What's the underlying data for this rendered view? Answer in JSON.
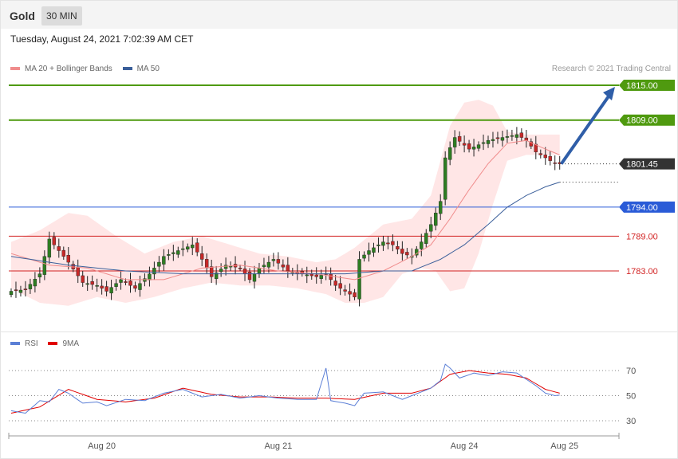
{
  "header": {
    "symbol": "Gold",
    "interval": "30 MIN"
  },
  "timestamp": "Tuesday, August 24, 2021 7:02:39 AM CET",
  "legend": {
    "main": [
      {
        "label": "MA 20 + Bollinger Bands",
        "color": "#f08c8c"
      },
      {
        "label": "MA 50",
        "color": "#3b5f9a"
      }
    ],
    "rsi": [
      {
        "label": "RSI",
        "color": "#5b7fd6"
      },
      {
        "label": "9MA",
        "color": "#e00000"
      }
    ]
  },
  "credit": "Research © 2021 Trading Central",
  "chart_data": [
    {
      "type": "candlestick",
      "ylim": [
        1776,
        1818
      ],
      "levels": [
        {
          "label": "1815.00",
          "value": 1815.0,
          "kind": "resistance",
          "color": "#4f9a0f"
        },
        {
          "label": "1809.00",
          "value": 1809.0,
          "kind": "resistance",
          "color": "#4f9a0f"
        },
        {
          "label": "1801.45",
          "value": 1801.45,
          "kind": "last-price",
          "color": "#333333"
        },
        {
          "label": "1794.00",
          "value": 1794.0,
          "kind": "pivot",
          "color": "#2a5bd7"
        },
        {
          "label": "1789.00",
          "value": 1789.0,
          "kind": "support",
          "color": "#d22222"
        },
        {
          "label": "1783.00",
          "value": 1783.0,
          "kind": "support",
          "color": "#d22222"
        }
      ],
      "target_arrow": {
        "from": 1801.45,
        "to": 1815.0,
        "color": "#2f5ea8"
      },
      "x_labels": [
        "Aug 20",
        "Aug 21",
        "Aug 24",
        "Aug 25"
      ],
      "close_anchors": [
        [
          0,
          1779.5
        ],
        [
          3,
          1779.8
        ],
        [
          6,
          1782.5
        ],
        [
          8,
          1788.5
        ],
        [
          10,
          1786.5
        ],
        [
          12,
          1784.5
        ],
        [
          15,
          1781.0
        ],
        [
          18,
          1780.5
        ],
        [
          20,
          1779.5
        ],
        [
          23,
          1781.5
        ],
        [
          26,
          1780.0
        ],
        [
          29,
          1782.5
        ],
        [
          32,
          1785.5
        ],
        [
          35,
          1786.5
        ],
        [
          38,
          1787.5
        ],
        [
          40,
          1785.0
        ],
        [
          42,
          1782.0
        ],
        [
          45,
          1784.0
        ],
        [
          48,
          1783.5
        ],
        [
          50,
          1781.5
        ],
        [
          52,
          1783.5
        ],
        [
          55,
          1785.0
        ],
        [
          58,
          1783.0
        ],
        [
          61,
          1782.5
        ],
        [
          64,
          1782.0
        ],
        [
          66,
          1782.5
        ],
        [
          68,
          1780.5
        ],
        [
          70,
          1779.5
        ],
        [
          72,
          1778.5
        ],
        [
          73,
          1785.0
        ],
        [
          75,
          1786.5
        ],
        [
          78,
          1788.0
        ],
        [
          80,
          1787.5
        ],
        [
          82,
          1786.0
        ],
        [
          84,
          1785.5
        ],
        [
          86,
          1788.0
        ],
        [
          88,
          1791.0
        ],
        [
          90,
          1795.0
        ],
        [
          91,
          1802.5
        ],
        [
          93,
          1806.0
        ],
        [
          96,
          1804.0
        ],
        [
          100,
          1805.5
        ],
        [
          103,
          1806.0
        ],
        [
          106,
          1806.5
        ],
        [
          108,
          1805.5
        ],
        [
          110,
          1803.5
        ],
        [
          112,
          1802.5
        ],
        [
          114,
          1801.5
        ],
        [
          115,
          1801.45
        ]
      ],
      "ma20_anchors": [
        [
          0,
          1786.0
        ],
        [
          8,
          1784.0
        ],
        [
          16,
          1783.5
        ],
        [
          24,
          1781.5
        ],
        [
          32,
          1781.5
        ],
        [
          40,
          1783.5
        ],
        [
          48,
          1784.0
        ],
        [
          56,
          1783.0
        ],
        [
          64,
          1782.5
        ],
        [
          72,
          1781.5
        ],
        [
          78,
          1783.0
        ],
        [
          84,
          1785.5
        ],
        [
          88,
          1787.5
        ],
        [
          92,
          1792.0
        ],
        [
          96,
          1797.0
        ],
        [
          100,
          1801.5
        ],
        [
          104,
          1805.0
        ],
        [
          108,
          1805.5
        ],
        [
          112,
          1804.0
        ],
        [
          115,
          1803.0
        ]
      ],
      "bb_upper_anchors": [
        [
          0,
          1788.0
        ],
        [
          6,
          1790.0
        ],
        [
          12,
          1793.0
        ],
        [
          16,
          1792.5
        ],
        [
          22,
          1789.0
        ],
        [
          28,
          1786.0
        ],
        [
          34,
          1788.0
        ],
        [
          40,
          1789.0
        ],
        [
          46,
          1787.5
        ],
        [
          52,
          1786.0
        ],
        [
          58,
          1785.5
        ],
        [
          64,
          1784.5
        ],
        [
          68,
          1785.0
        ],
        [
          72,
          1787.0
        ],
        [
          78,
          1791.0
        ],
        [
          84,
          1792.0
        ],
        [
          88,
          1796.0
        ],
        [
          92,
          1808.0
        ],
        [
          95,
          1812.0
        ],
        [
          98,
          1812.5
        ],
        [
          101,
          1811.5
        ],
        [
          104,
          1807.0
        ],
        [
          108,
          1806.5
        ],
        [
          115,
          1806.5
        ]
      ],
      "bb_lower_anchors": [
        [
          0,
          1780.0
        ],
        [
          6,
          1777.5
        ],
        [
          12,
          1777.0
        ],
        [
          18,
          1778.5
        ],
        [
          24,
          1777.5
        ],
        [
          30,
          1778.5
        ],
        [
          36,
          1780.0
        ],
        [
          42,
          1781.0
        ],
        [
          48,
          1780.5
        ],
        [
          54,
          1780.5
        ],
        [
          60,
          1780.0
        ],
        [
          66,
          1779.0
        ],
        [
          70,
          1777.5
        ],
        [
          74,
          1777.5
        ],
        [
          78,
          1778.5
        ],
        [
          82,
          1782.5
        ],
        [
          86,
          1783.5
        ],
        [
          89,
          1783.0
        ],
        [
          92,
          1779.5
        ],
        [
          95,
          1780.0
        ],
        [
          98,
          1786.0
        ],
        [
          101,
          1794.5
        ],
        [
          104,
          1802.0
        ],
        [
          108,
          1803.0
        ],
        [
          115,
          1803.0
        ]
      ],
      "ma50_anchors": [
        [
          0,
          1785.5
        ],
        [
          12,
          1784.0
        ],
        [
          24,
          1783.0
        ],
        [
          36,
          1782.5
        ],
        [
          48,
          1782.5
        ],
        [
          60,
          1782.5
        ],
        [
          70,
          1782.5
        ],
        [
          78,
          1783.0
        ],
        [
          84,
          1783.0
        ],
        [
          90,
          1785.0
        ],
        [
          95,
          1787.5
        ],
        [
          100,
          1791.0
        ],
        [
          104,
          1794.0
        ],
        [
          108,
          1796.0
        ],
        [
          112,
          1797.5
        ],
        [
          115,
          1798.3
        ]
      ]
    },
    {
      "type": "line",
      "ylim": [
        20,
        80
      ],
      "levels": [
        {
          "label": "70",
          "value": 70
        },
        {
          "label": "50",
          "value": 50
        },
        {
          "label": "30",
          "value": 30
        }
      ],
      "rsi_anchors": [
        [
          0,
          38
        ],
        [
          3,
          36
        ],
        [
          6,
          46
        ],
        [
          8,
          45
        ],
        [
          10,
          55
        ],
        [
          12,
          52
        ],
        [
          15,
          44
        ],
        [
          18,
          45
        ],
        [
          20,
          42
        ],
        [
          24,
          47
        ],
        [
          28,
          46
        ],
        [
          32,
          52
        ],
        [
          36,
          55
        ],
        [
          40,
          49
        ],
        [
          44,
          51
        ],
        [
          48,
          48
        ],
        [
          52,
          50
        ],
        [
          56,
          48
        ],
        [
          60,
          47
        ],
        [
          64,
          47
        ],
        [
          66,
          72
        ],
        [
          67,
          46
        ],
        [
          70,
          44
        ],
        [
          72,
          42
        ],
        [
          74,
          52
        ],
        [
          78,
          53
        ],
        [
          82,
          47
        ],
        [
          86,
          53
        ],
        [
          88,
          56
        ],
        [
          90,
          62
        ],
        [
          91,
          75
        ],
        [
          92,
          72
        ],
        [
          94,
          64
        ],
        [
          97,
          68
        ],
        [
          100,
          66
        ],
        [
          103,
          69
        ],
        [
          106,
          68
        ],
        [
          108,
          63
        ],
        [
          110,
          58
        ],
        [
          112,
          52
        ],
        [
          114,
          50
        ],
        [
          115,
          50.5
        ]
      ],
      "ma9_anchors": [
        [
          0,
          36
        ],
        [
          6,
          41
        ],
        [
          12,
          55
        ],
        [
          18,
          47
        ],
        [
          24,
          45
        ],
        [
          30,
          48
        ],
        [
          36,
          56
        ],
        [
          42,
          51
        ],
        [
          48,
          49
        ],
        [
          54,
          49
        ],
        [
          60,
          48
        ],
        [
          66,
          48
        ],
        [
          72,
          47
        ],
        [
          78,
          52
        ],
        [
          84,
          52
        ],
        [
          88,
          56
        ],
        [
          92,
          67
        ],
        [
          96,
          70
        ],
        [
          100,
          68
        ],
        [
          104,
          67
        ],
        [
          108,
          64
        ],
        [
          112,
          55
        ],
        [
          115,
          52
        ]
      ]
    }
  ]
}
